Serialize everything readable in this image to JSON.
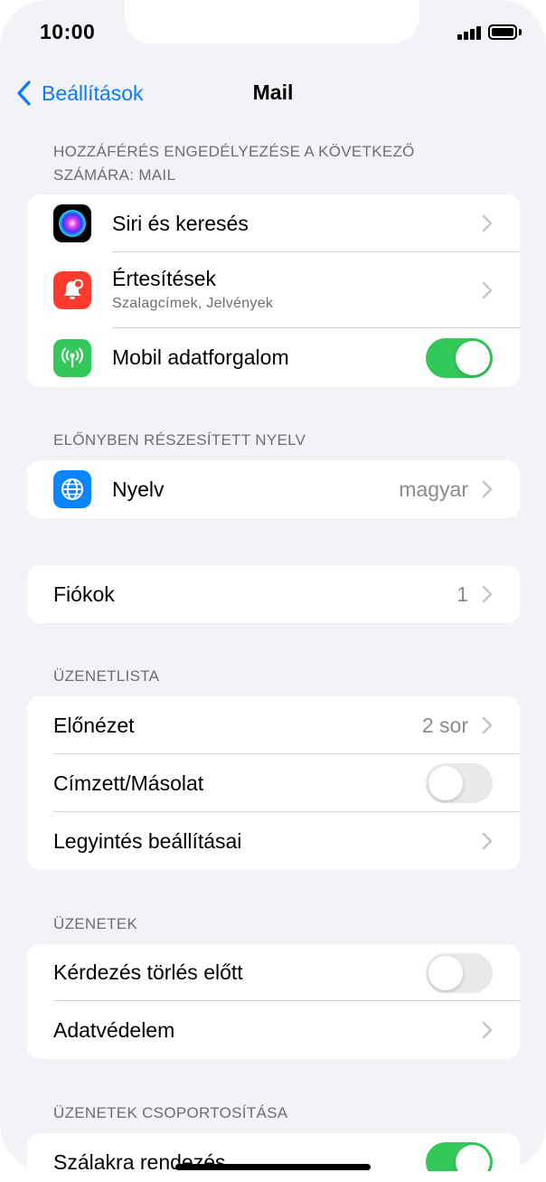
{
  "status_bar": {
    "time": "10:00"
  },
  "nav": {
    "back_label": "Beállítások",
    "title": "Mail"
  },
  "sections": {
    "access": {
      "header": "HOZZÁFÉRÉS ENGEDÉLYEZÉSE A KÖVETKEZŐ SZÁMÁRA: MAIL",
      "siri_label": "Siri és keresés",
      "notifications_label": "Értesítések",
      "notifications_sub": "Szalagcímek, Jelvények",
      "mobile_data_label": "Mobil adatforgalom",
      "mobile_data_on": true
    },
    "language": {
      "header": "ELŐNYBEN RÉSZESÍTETT NYELV",
      "label": "Nyelv",
      "value": "magyar"
    },
    "accounts": {
      "label": "Fiókok",
      "value": "1"
    },
    "message_list": {
      "header": "ÜZENETLISTA",
      "preview_label": "Előnézet",
      "preview_value": "2 sor",
      "tocc_label": "Címzett/Másolat",
      "tocc_on": false,
      "swipe_label": "Legyintés beállításai"
    },
    "messages": {
      "header": "ÜZENETEK",
      "ask_delete_label": "Kérdezés törlés előtt",
      "ask_delete_on": false,
      "privacy_label": "Adatvédelem"
    },
    "threading": {
      "header": "ÜZENETEK CSOPORTOSÍTÁSA",
      "organize_label": "Szálakra rendezés",
      "organize_on": true
    }
  },
  "icons": {
    "siri": "siri-icon",
    "notifications": "bell-icon",
    "mobile_data": "antenna-icon",
    "language": "globe-icon",
    "back": "chevron-left-icon",
    "disclosure": "chevron-right-icon"
  },
  "colors": {
    "accent": "#0a7aff",
    "toggle_on": "#34c759",
    "notifications_icon_bg": "#ff3b30",
    "mobile_data_icon_bg": "#34c759",
    "language_icon_bg": "#0a84ff"
  }
}
